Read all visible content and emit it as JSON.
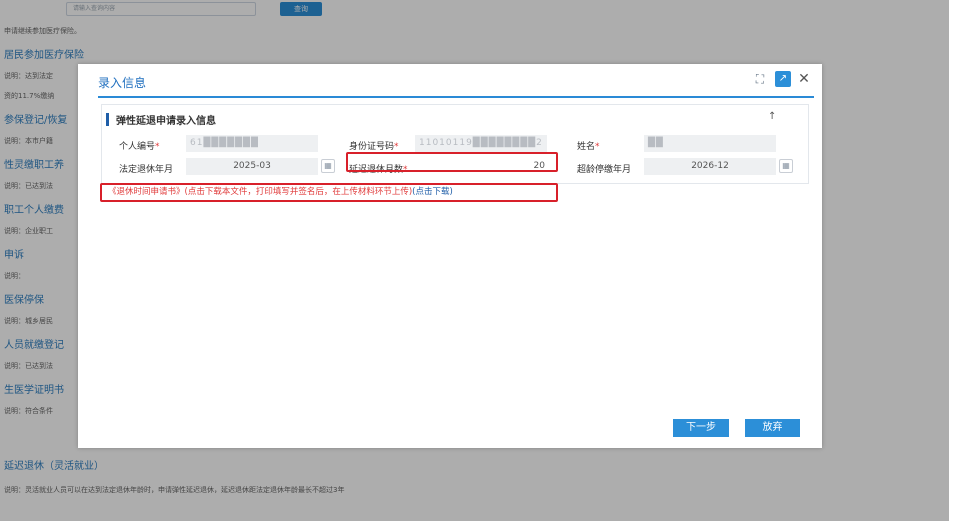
{
  "background": {
    "search_placeholder": "请输入查询内容",
    "search_button": "查询",
    "rows": [
      {
        "kind": "desc",
        "text": "申请继续参加医疗保险。"
      },
      {
        "kind": "title",
        "text": "居民参加医疗保险"
      },
      {
        "kind": "desc",
        "text": "说明：达到法定"
      },
      {
        "kind": "desc",
        "text": "资的11.7%缴纳"
      },
      {
        "kind": "title",
        "text": "参保登记/恢复"
      },
      {
        "kind": "desc",
        "text": "说明：本市户籍"
      },
      {
        "kind": "title",
        "text": "性灵缴职工养"
      },
      {
        "kind": "desc",
        "text": "说明：已达到法"
      },
      {
        "kind": "title",
        "text": "职工个人缴费"
      },
      {
        "kind": "desc",
        "text": "说明：企业职工"
      },
      {
        "kind": "title",
        "text": "申诉"
      },
      {
        "kind": "desc",
        "text": "说明："
      },
      {
        "kind": "title",
        "text": "医保停保"
      },
      {
        "kind": "desc",
        "text": "说明：城乡居民"
      },
      {
        "kind": "title",
        "text": "人员就缴登记"
      },
      {
        "kind": "desc",
        "text": "说明：已达到法"
      },
      {
        "kind": "title",
        "text": "生医学证明书"
      },
      {
        "kind": "desc",
        "text": "说明：符合条件"
      },
      {
        "kind": "title",
        "text": "延迟退休（灵活就业）"
      },
      {
        "kind": "desc",
        "text": "说明：灵活就业人员可以在达到法定退休年龄时，申请弹性延迟退休，延迟退休距法定退休年龄最长不超过3年"
      }
    ]
  },
  "modal": {
    "title": "录入信息",
    "icons": {
      "fullscreen": "fullscreen-icon",
      "export": "export-icon",
      "close": "close-icon"
    },
    "section_title": "弹性延退申请录入信息",
    "fields": {
      "person_id_label": "个人编号",
      "person_id_value": "61███████",
      "id_card_label": "身份证号码",
      "id_card_value": "11010119████████2",
      "name_label": "姓名",
      "name_value": "██",
      "legal_retire_label": "法定退休年月",
      "legal_retire_value": "2025-03",
      "delay_months_label": "延迟退休月数",
      "delay_months_value": "20",
      "overage_stop_label": "超龄停缴年月",
      "overage_stop_value": "2026-12"
    },
    "notice_text": "《退休时间申请书》(点击下载本文件，打印填写并签名后，在上传材料环节上传)",
    "notice_download": "(点击下载)",
    "buttons": {
      "next": "下一步",
      "abandon": "放弃"
    }
  },
  "colors": {
    "accent": "#2c8fd8",
    "required": "#e03a3a",
    "highlight_border": "#d8202a"
  }
}
